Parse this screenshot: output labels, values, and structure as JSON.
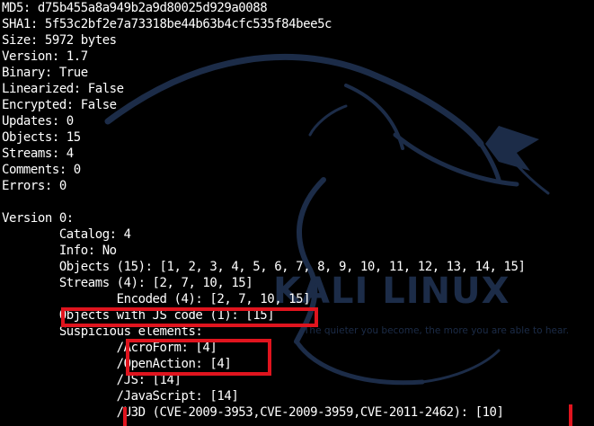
{
  "terminal": {
    "lines": [
      "MD5: d75b455a8a949b2a9d80025d929a0088",
      "SHA1: 5f53c2bf2e7a73318be44b63b4cfc535f84bee5c",
      "Size: 5972 bytes",
      "Version: 1.7",
      "Binary: True",
      "Linearized: False",
      "Encrypted: False",
      "Updates: 0",
      "Objects: 15",
      "Streams: 4",
      "Comments: 0",
      "Errors: 0",
      "",
      "Version 0:",
      "        Catalog: 4",
      "        Info: No",
      "        Objects (15): [1, 2, 3, 4, 5, 6, 7, 8, 9, 10, 11, 12, 13, 14, 15]",
      "        Streams (4): [2, 7, 10, 15]",
      "                Encoded (4): [2, 7, 10, 15]",
      "        Objects with JS code (1): [15]",
      "        Suspicious elements:",
      "                /AcroForm: [4]",
      "                /OpenAction: [4]",
      "                /JS: [14]",
      "                /JavaScript: [14]",
      "                /U3D (CVE-2009-3953,CVE-2009-3959,CVE-2011-2462): [10]"
    ]
  },
  "wallpaper": {
    "logo_text": "KALI LINUX",
    "tagline": "The quieter you become, the more you are able to hear.",
    "color": "#1c2c48"
  },
  "colors": {
    "background": "#000000",
    "text": "#ffffff",
    "highlight": "#e0141e"
  }
}
